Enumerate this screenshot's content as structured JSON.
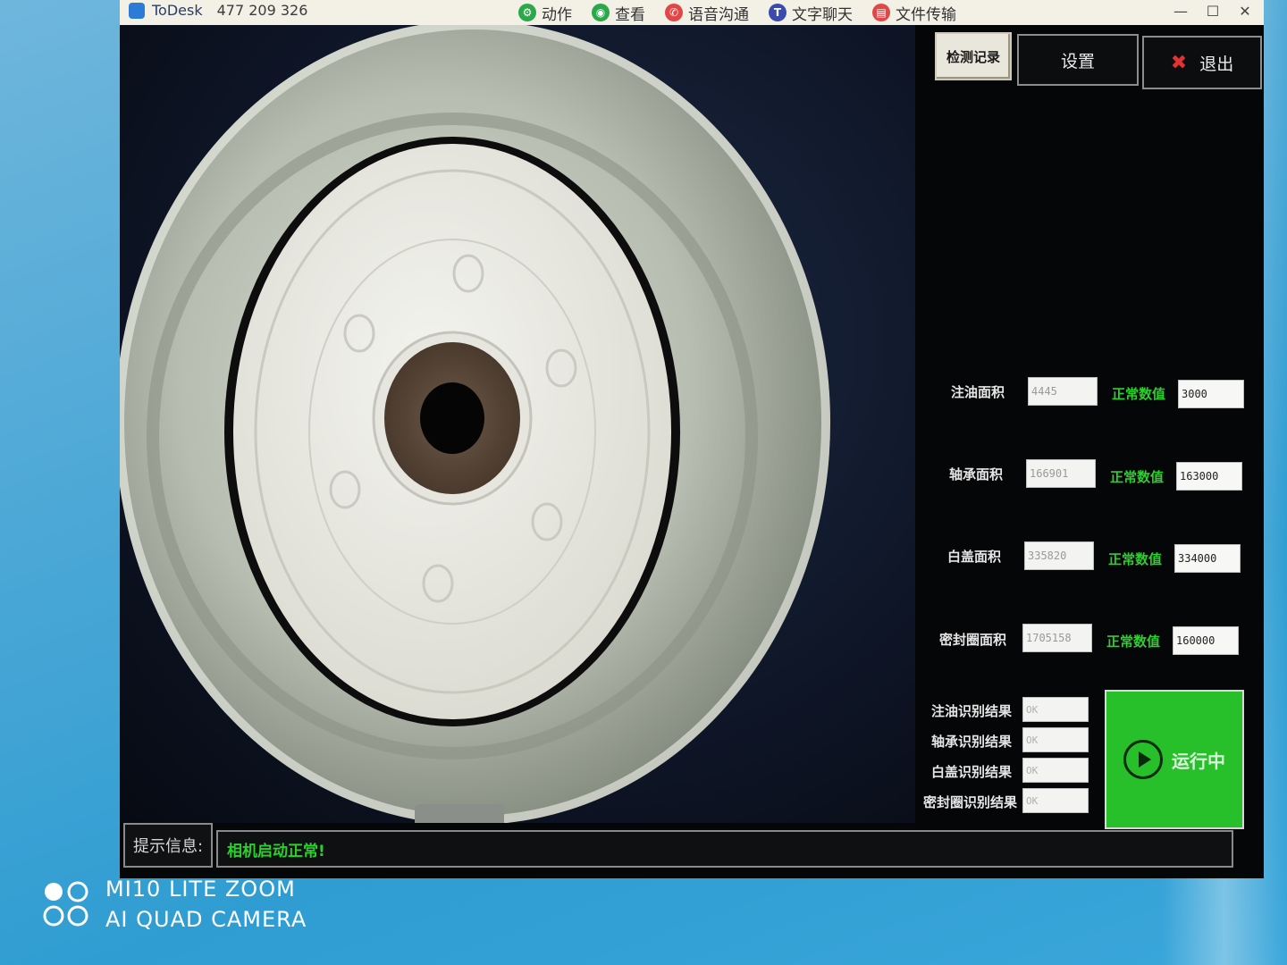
{
  "toolbar": {
    "brand": "ToDesk",
    "device_id": "477 209 326",
    "actions": [
      {
        "label": "动作",
        "color": "#2aa84a"
      },
      {
        "label": "查看",
        "color": "#2aa84a"
      },
      {
        "label": "语音沟通",
        "color": "#e04848"
      },
      {
        "label": "文字聊天",
        "color": "#3a4bb0"
      },
      {
        "label": "文件传输",
        "color": "#e04848"
      }
    ],
    "window_controls": [
      "—",
      "☐",
      "✕"
    ]
  },
  "buttons": {
    "record": "检测记录",
    "settings": "设置",
    "exit": "退出",
    "exit_icon": "✖"
  },
  "measurements": [
    {
      "label": "注油面积",
      "value": "4445",
      "normal_label": "正常数值",
      "normal_value": "3000"
    },
    {
      "label": "轴承面积",
      "value": "166901",
      "normal_label": "正常数值",
      "normal_value": "163000"
    },
    {
      "label": "白盖面积",
      "value": "335820",
      "normal_label": "正常数值",
      "normal_value": "334000"
    },
    {
      "label": "密封圈面积",
      "value": "1705158",
      "normal_label": "正常数值",
      "normal_value": "160000"
    }
  ],
  "results": [
    {
      "label": "注油识别结果",
      "value": "OK"
    },
    {
      "label": "轴承识别结果",
      "value": "OK"
    },
    {
      "label": "白盖识别结果",
      "value": "OK"
    },
    {
      "label": "密封圈识别结果",
      "value": "OK"
    }
  ],
  "run_button": "运行中",
  "status": {
    "label": "提示信息:",
    "message": "相机启动正常!"
  },
  "watermark": {
    "line1": "MI10 LITE ZOOM",
    "line2": "AI QUAD CAMERA"
  },
  "colors": {
    "ok_green": "#2bd12b",
    "run_green": "#27c02a",
    "panel_bg": "#050607"
  }
}
